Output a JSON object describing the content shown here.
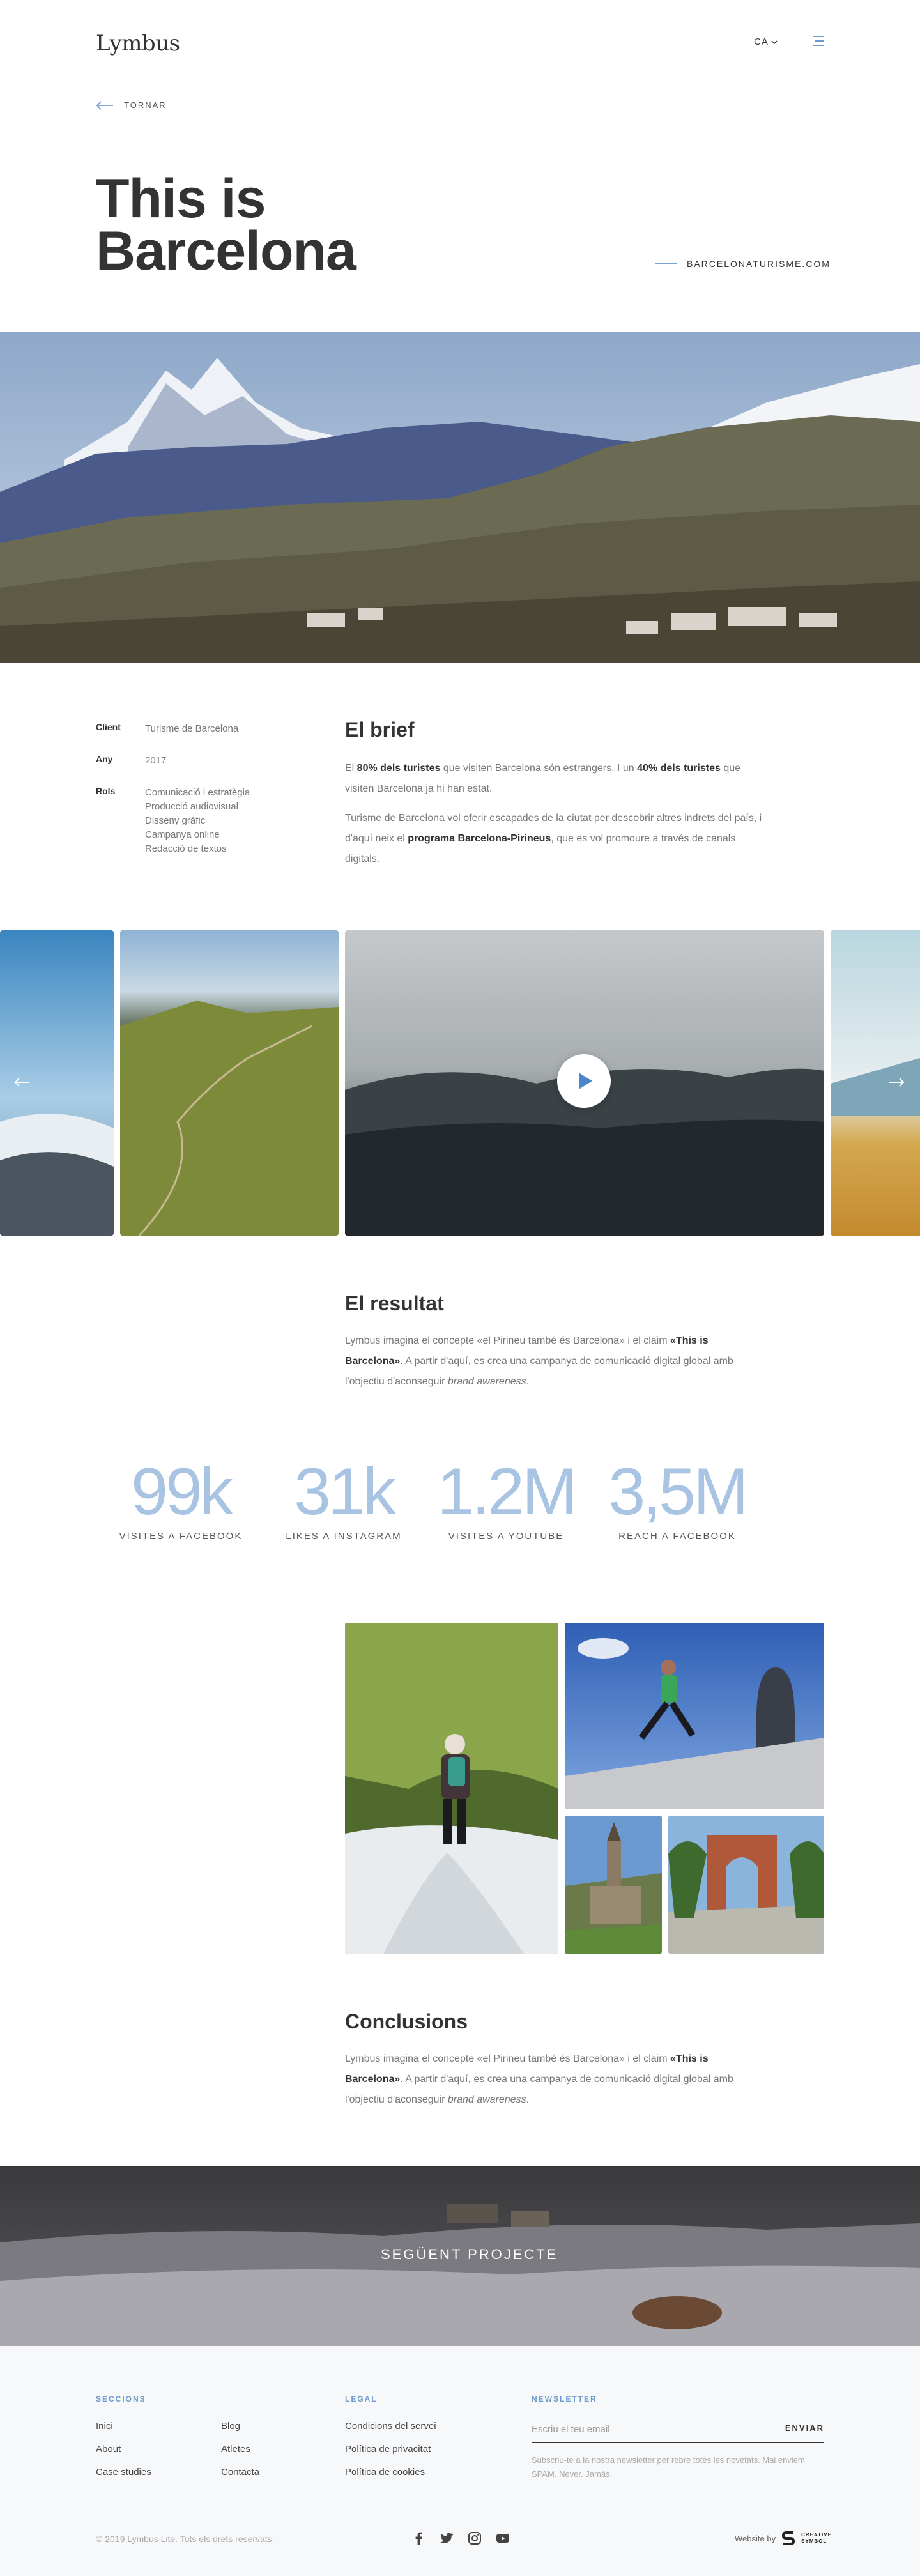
{
  "header": {
    "logo": "Lymbus",
    "lang": "CA",
    "back_label": "TORNAR"
  },
  "hero": {
    "title_line1": "This is",
    "title_line2": "Barcelona",
    "site_link": "BARCELONATURISME.COM"
  },
  "meta": [
    {
      "key": "Client",
      "value": "Turisme de Barcelona"
    },
    {
      "key": "Any",
      "value": "2017"
    },
    {
      "key": "Rols",
      "values": [
        "Comunicació i estratègia",
        "Producció audiovisual",
        "Disseny gràfic",
        "Campanya online",
        "Redacció de textos"
      ]
    }
  ],
  "brief": {
    "title": "El brief",
    "p1_a": "El ",
    "p1_b": "80% dels turistes",
    "p1_c": " que visiten Barcelona són estrangers. I un ",
    "p1_d": "40% dels turistes",
    "p1_e": " que visiten Barcelona ja hi han estat.",
    "p2_a": "Turisme de Barcelona vol oferir escapades de la ciutat per descobrir altres indrets del país, i d'aquí neix el ",
    "p2_b": "programa Barcelona-Pirineus",
    "p2_c": ", que es vol promoure a través de canals digitals."
  },
  "result": {
    "title": "El resultat",
    "p_a": "Lymbus imagina el concepte «el Pirineu també és Barcelona» i el claim ",
    "p_b": "«This is Barcelona»",
    "p_c": ". A partir d'aquí, es crea una campanya de comunicació digital global amb l'objectiu d'aconseguir ",
    "p_d": "brand awareness",
    "p_e": "."
  },
  "stats": [
    {
      "num": "99k",
      "label": "VISITES A FACEBOOK"
    },
    {
      "num": "31k",
      "label": "LIKES A INSTAGRAM"
    },
    {
      "num": "1.2M",
      "label": "VISITES A YOUTUBE"
    },
    {
      "num": "3,5M",
      "label": "REACH A FACEBOOK"
    }
  ],
  "conclusions": {
    "title": "Conclusions",
    "p_a": "Lymbus imagina el concepte «el Pirineu també és Barcelona» i el claim ",
    "p_b": "«This is Barcelona»",
    "p_c": ". A partir d'aquí, es crea una campanya de comunicació digital global amb l'objectiu d'aconseguir ",
    "p_d": "brand awareness",
    "p_e": "."
  },
  "next_project": "SEGÜENT PROJECTE",
  "footer": {
    "sections_title": "SECCIONS",
    "sections_col1": [
      "Inici",
      "About",
      "Case studies"
    ],
    "sections_col2": [
      "Blog",
      "Atletes",
      "Contacta"
    ],
    "legal_title": "LEGAL",
    "legal": [
      "Condicions del servei",
      "Política de privacitat",
      "Política de cookies"
    ],
    "newsletter_title": "NEWSLETTER",
    "newsletter_placeholder": "Escriu el teu email",
    "newsletter_send": "ENVIAR",
    "newsletter_note": "Subscriu-te a la nostra newsletter per rebre totes les novetats. Mai enviem SPAM. Never. Jamás.",
    "copyright": "© 2019 Lymbus Lite. Tots els drets reservats.",
    "credit_prefix": "Website by",
    "credit_brand_line1": "CREATIVE",
    "credit_brand_line2": "SYMBOL"
  },
  "colors": {
    "accent": "#7aa3d1",
    "stat": "#a9c3e2",
    "footer_bg": "#f7f8fa",
    "text": "#333333"
  }
}
